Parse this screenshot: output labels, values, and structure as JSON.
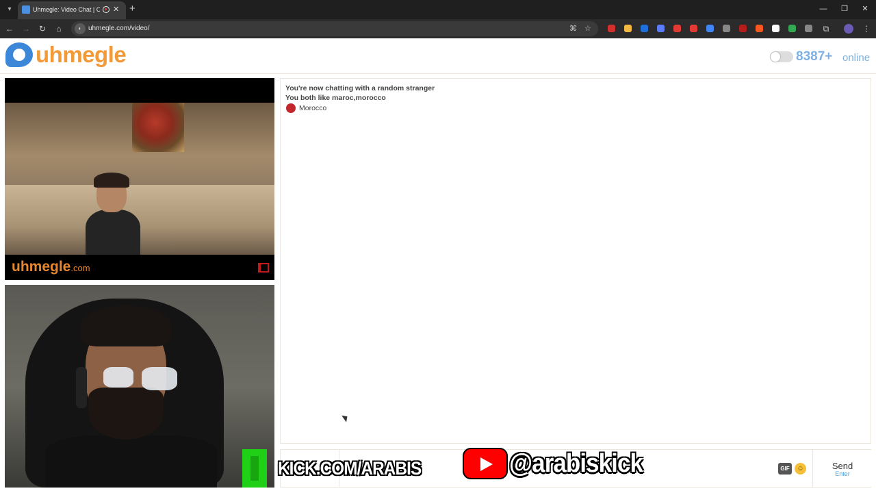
{
  "browser": {
    "tab_title": "Uhmegle: Video Chat | Om",
    "url": "uhmegle.com/video/",
    "extension_colors": [
      "#d32f2f",
      "#f4b942",
      "#1e6fd9",
      "#5c7cfa",
      "#e53935",
      "#e53935",
      "#4285f4",
      "#888888",
      "#b71c1c",
      "#ff5722",
      "#ffffff",
      "#34a853",
      "#888888"
    ]
  },
  "header": {
    "logo_text": "uhmegle",
    "online_count": "8387+",
    "online_label": "online"
  },
  "video": {
    "stranger_watermark": "uhmegle",
    "stranger_watermark_suffix": ".com"
  },
  "chat": {
    "messages": [
      "You're now chatting with a random stranger",
      "You both like maroc,morocco"
    ],
    "country": "Morocco",
    "input_placeholder": "",
    "gif_label": "GIF",
    "send_label": "Send",
    "send_sub": "Enter"
  },
  "overlays": {
    "kick": "KICK.COM/ARABIS",
    "youtube": "@arabiskick"
  },
  "colors": {
    "brand_blue": "#3c87d8",
    "brand_orange": "#f29a38",
    "online_blue": "#7fb2e3",
    "flag_red": "#c1272d"
  }
}
